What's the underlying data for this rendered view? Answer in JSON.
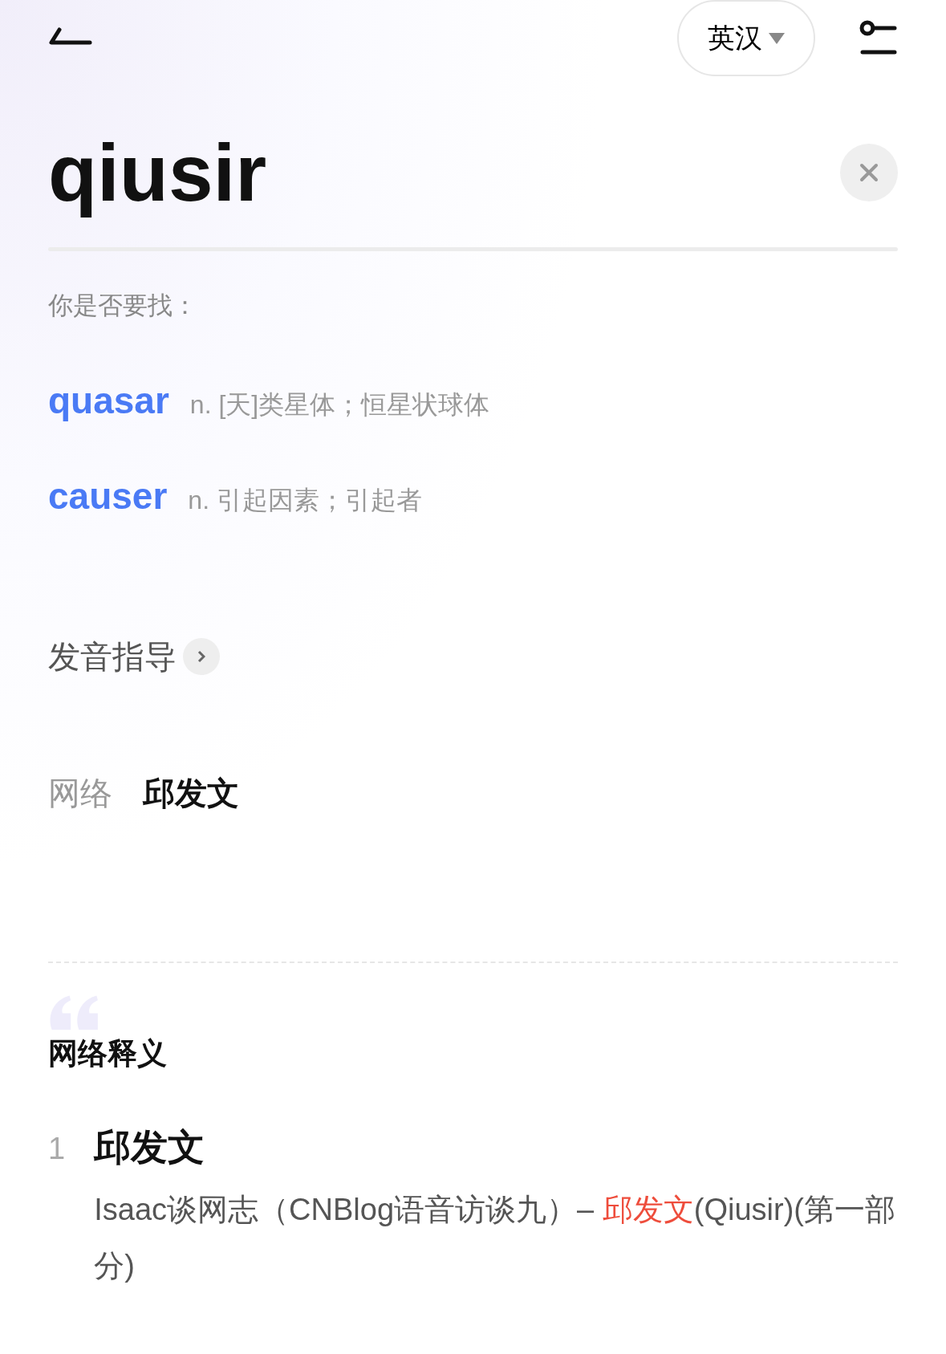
{
  "header": {
    "language": "英汉"
  },
  "search": {
    "value": "qiusir"
  },
  "suggestions_title": "你是否要找：",
  "suggestions": [
    {
      "word": "quasar",
      "meaning": "n. [天]类星体；恒星状球体"
    },
    {
      "word": "causer",
      "meaning": "n. 引起因素；引起者"
    }
  ],
  "pronunciation_guide": "发音指导",
  "web_row": {
    "label": "网络",
    "value": "邱发文"
  },
  "web_definitions": {
    "title": "网络释义",
    "items": [
      {
        "number": "1",
        "term": "邱发文",
        "example": [
          {
            "text": "Isaac谈网志（CNBlog语音访谈九）– ",
            "highlight": false
          },
          {
            "text": "邱发文",
            "highlight": true
          },
          {
            "text": "(Qiusir)(第一部分)",
            "highlight": false
          }
        ]
      }
    ]
  }
}
